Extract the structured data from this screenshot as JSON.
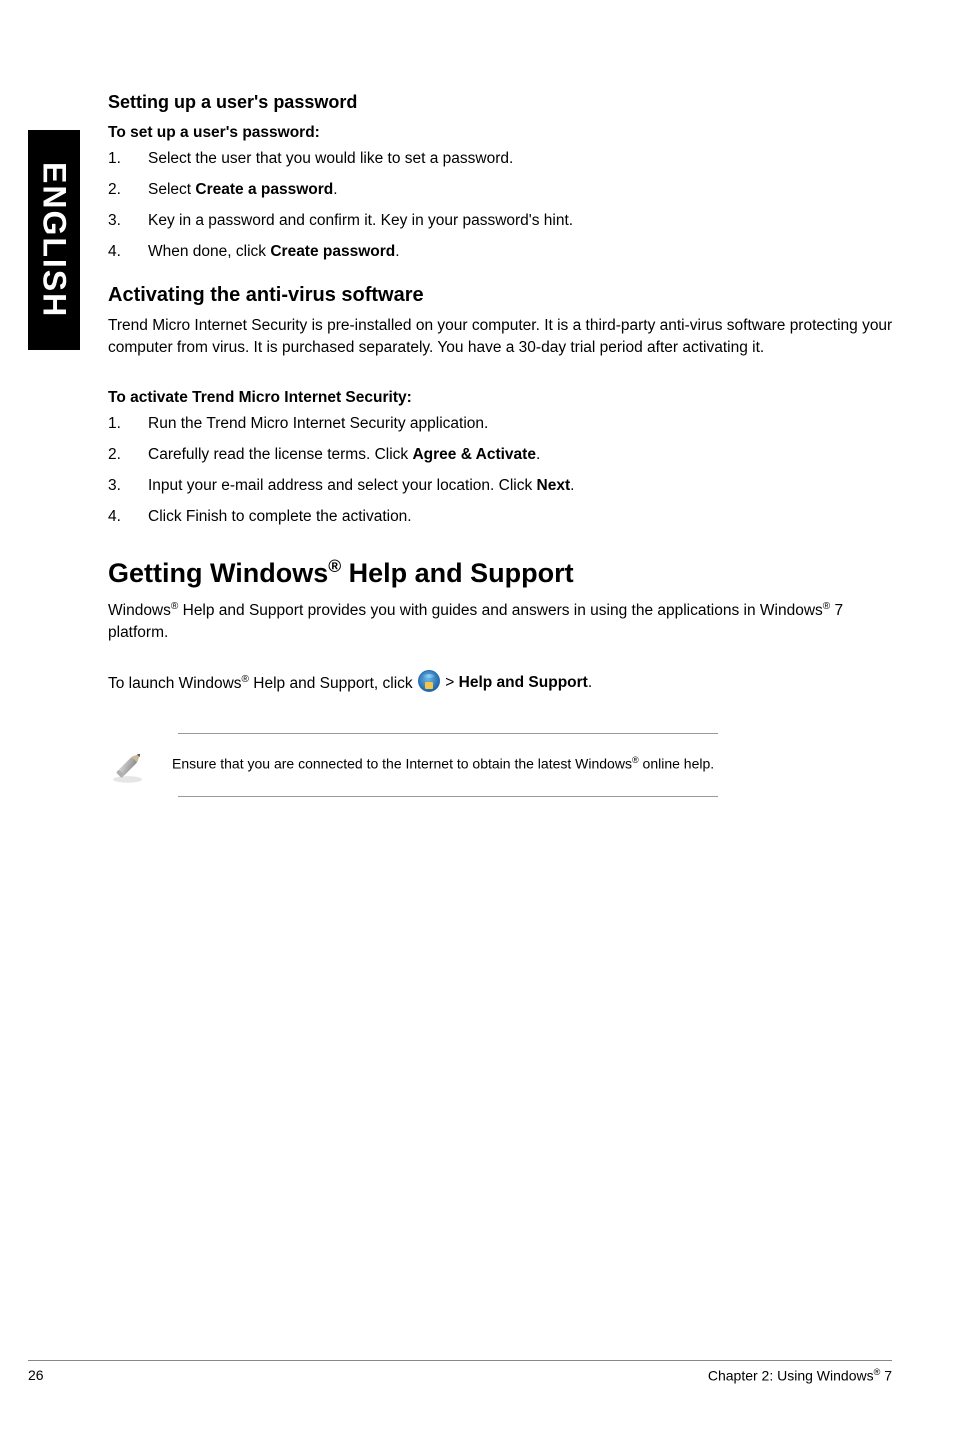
{
  "sidetab": "ENGLISH",
  "sec1": {
    "heading": "Setting up a user's password",
    "sub": "To set up a user's password:",
    "steps": [
      "Select the user that you would like to set a password.",
      "Select <b>Create a password</b>.",
      "Key in a password and confirm it. Key in your password's hint.",
      "When done, click <b>Create password</b>."
    ]
  },
  "sec2": {
    "heading": "Activating the anti-virus software",
    "para": "Trend Micro Internet Security is pre-installed on your computer. It is a third-party anti-virus software protecting your computer from virus. It is purchased separately. You have a 30-day trial period after activating it.",
    "sub": "To activate Trend Micro Internet Security:",
    "steps": [
      "Run the Trend Micro Internet Security application.",
      "Carefully read the license terms. Click <b>Agree & Activate</b>.",
      "Input your e-mail address and select your location. Click <b>Next</b>.",
      "Click Finish to complete the activation."
    ]
  },
  "sec3": {
    "heading": "Getting Windows<sup>®</sup> Help and Support",
    "para": "Windows<sup>®</sup> Help and Support provides you with guides and answers in using the applications in Windows<sup>®</sup> 7 platform.",
    "launch_pre": "To launch Windows<sup>®</sup> Help and Support, click ",
    "launch_post": " > <b>Help and Support</b>.",
    "note": "Ensure that you are connected to the Internet to obtain the latest Windows<sup>®</sup> online help."
  },
  "footer": {
    "page": "26",
    "chapter": "Chapter 2: Using Windows<sup>®</sup> 7"
  }
}
